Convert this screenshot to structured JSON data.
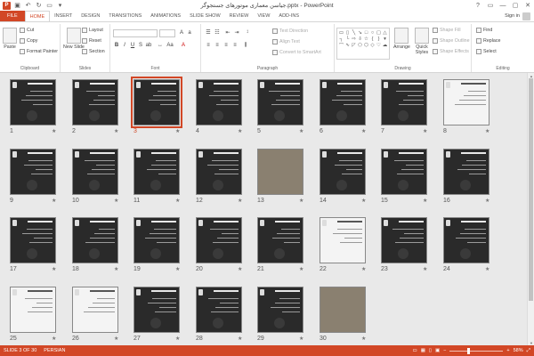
{
  "window": {
    "title": "جیاسن معماری موتورهای جستجوگر.pptx - PowerPoint",
    "app_icon": "P",
    "controls": [
      "?",
      "▭",
      "—",
      "▢",
      "✕"
    ]
  },
  "tabs": [
    {
      "label": "FILE"
    },
    {
      "label": "HOME"
    },
    {
      "label": "INSERT"
    },
    {
      "label": "DESIGN"
    },
    {
      "label": "TRANSITIONS"
    },
    {
      "label": "ANIMATIONS"
    },
    {
      "label": "SLIDE SHOW"
    },
    {
      "label": "REVIEW"
    },
    {
      "label": "VIEW"
    },
    {
      "label": "ADD-INS"
    }
  ],
  "signin": "Sign in",
  "ribbon": {
    "clipboard": {
      "paste": "Paste",
      "cut": "Cut",
      "copy": "Copy",
      "format_painter": "Format Painter",
      "label": "Clipboard"
    },
    "slides": {
      "new_slide": "New Slide",
      "layout": "Layout",
      "reset": "Reset",
      "section": "Section",
      "label": "Slides"
    },
    "font": {
      "label": "Font"
    },
    "paragraph": {
      "text_direction": "Text Direction",
      "align_text": "Align Text",
      "convert": "Convert to SmartArt",
      "label": "Paragraph"
    },
    "drawing": {
      "arrange": "Arrange",
      "quick_styles": "Quick Styles",
      "shape_fill": "Shape Fill",
      "shape_outline": "Shape Outline",
      "shape_effects": "Shape Effects",
      "label": "Drawing"
    },
    "editing": {
      "find": "Find",
      "replace": "Replace",
      "select": "Select",
      "label": "Editing"
    }
  },
  "slides": [
    {
      "n": "1"
    },
    {
      "n": "2"
    },
    {
      "n": "3"
    },
    {
      "n": "4"
    },
    {
      "n": "5"
    },
    {
      "n": "6"
    },
    {
      "n": "7"
    },
    {
      "n": "8"
    },
    {
      "n": "9"
    },
    {
      "n": "10"
    },
    {
      "n": "11"
    },
    {
      "n": "12"
    },
    {
      "n": "13"
    },
    {
      "n": "14"
    },
    {
      "n": "15"
    },
    {
      "n": "16"
    },
    {
      "n": "17"
    },
    {
      "n": "18"
    },
    {
      "n": "19"
    },
    {
      "n": "20"
    },
    {
      "n": "21"
    },
    {
      "n": "22"
    },
    {
      "n": "23"
    },
    {
      "n": "24"
    },
    {
      "n": "25"
    },
    {
      "n": "26"
    },
    {
      "n": "27"
    },
    {
      "n": "28"
    },
    {
      "n": "29"
    },
    {
      "n": "30"
    }
  ],
  "selected_slide": 3,
  "status": {
    "slide_info": "SLIDE 3 OF 30",
    "language": "PERSIAN",
    "zoom": "58%"
  },
  "colors": {
    "accent": "#d24726",
    "sorter_bg": "#e9e9e9"
  }
}
